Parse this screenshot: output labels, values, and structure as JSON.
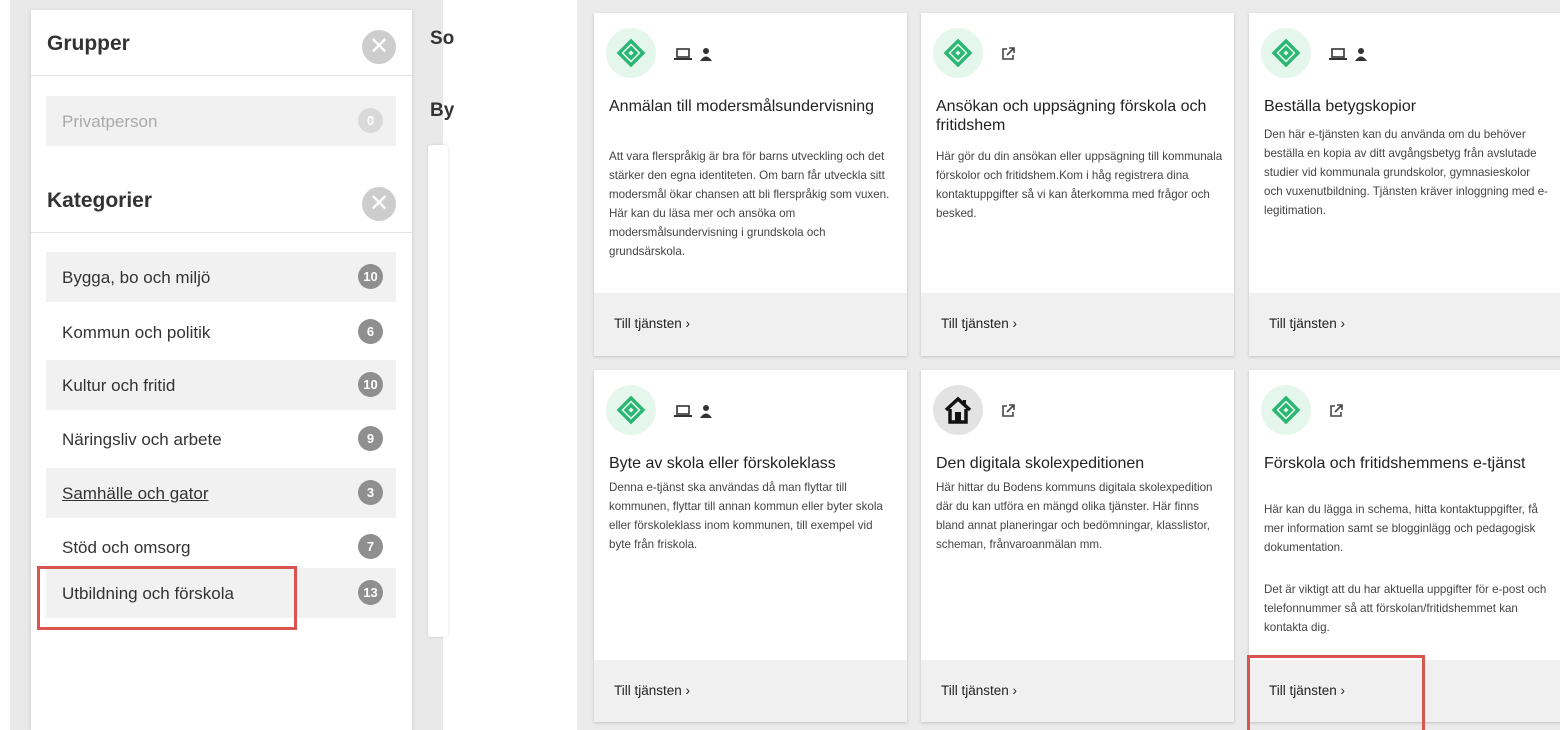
{
  "behind": {
    "so": "So",
    "by": "By"
  },
  "groups": {
    "title": "Grupper",
    "close": "✕",
    "items": [
      {
        "label": "Privatperson",
        "count": "0"
      }
    ]
  },
  "categories": {
    "title": "Kategorier",
    "close": "✕",
    "items": [
      {
        "label": "Bygga, bo och miljö",
        "count": "10"
      },
      {
        "label": "Kommun och politik",
        "count": "6"
      },
      {
        "label": "Kultur och fritid",
        "count": "10"
      },
      {
        "label": "Näringsliv och arbete",
        "count": "9"
      },
      {
        "label": "Samhälle och gator",
        "count": "3"
      },
      {
        "label": "Stöd och omsorg",
        "count": "7"
      },
      {
        "label": "Utbildning och förskola",
        "count": "13"
      }
    ]
  },
  "cards": [
    {
      "title": "Anmälan till modersmålsundervisning",
      "icons": [
        "laptop-icon",
        "person-icon"
      ],
      "description": "Att vara flerspråkig är bra för barns utveckling och det stärker den egna identiteten. Om barn får utveckla sitt modersmål ökar chansen att bli flerspråkig som vuxen. Här kan du läsa mer och ansöka om modersmålsundervisning i grundskola och grundsärskola.",
      "link": "Till tjänsten"
    },
    {
      "title": "Ansökan och uppsägning förskola och fritidshem",
      "icons": [
        "external-link-icon"
      ],
      "description": "Här gör du din ansökan eller uppsägning till kommunala förskolor och fritidshem.Kom i håg registrera dina kontaktuppgifter så vi kan återkomma med frågor och besked.",
      "link": "Till tjänsten"
    },
    {
      "title": "Beställa betygskopior",
      "icons": [
        "laptop-icon",
        "person-icon"
      ],
      "description": "Den här e-tjänsten kan du använda om du behöver beställa en kopia av ditt avgångsbetyg från avslutade studier vid kommunala grundskolor, gymnasieskolor och vuxenutbildning. Tjänsten kräver inloggning med e-legitimation.",
      "link": "Till tjänsten"
    },
    {
      "title": "Byte av skola eller förskoleklass",
      "icons": [
        "laptop-icon",
        "person-icon"
      ],
      "description": "Denna e-tjänst ska användas då man flyttar till kommunen, flyttar till annan kommun eller byter skola eller förskoleklass inom kommunen, till exempel vid byte från friskola.",
      "link": "Till tjänsten"
    },
    {
      "title": "Den digitala skolexpeditionen",
      "icons": [
        "external-link-icon"
      ],
      "description": "Här hittar du Bodens kommuns digitala skolexpedition där du kan utföra en mängd olika tjänster. Här finns bland annat planeringar och bedömningar, klasslistor, scheman, frånvaroanmälan mm.",
      "link": "Till tjänsten"
    },
    {
      "title": "Förskola och fritidshemmens e-tjänst",
      "icons": [
        "external-link-icon"
      ],
      "description": "Här kan du lägga in schema, hitta kontaktuppgifter, få mer information samt se blogginlägg och pedagogisk dokumentation.",
      "description2": "Det är viktigt att du har aktuella uppgifter för e-post och telefonnummer så att förskolan/fritidshemmet kan kontakta dig.",
      "link": "Till tjänsten"
    }
  ],
  "colors": {
    "accent_green": "#2bb673",
    "highlight": "#d9534f"
  }
}
